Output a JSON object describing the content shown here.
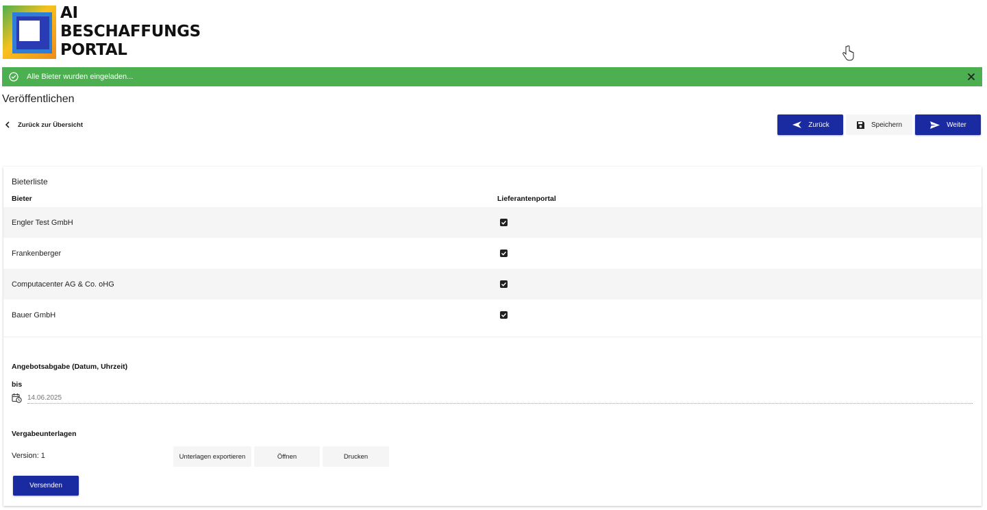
{
  "logo": {
    "line1": "AI",
    "line2": "BESCHAFFUNGS",
    "line3": "PORTAL"
  },
  "alert": {
    "message": "Alle Bieter wurden eingeladen...",
    "color": "#4caf50"
  },
  "page_title": "Veröffentlichen",
  "back_link": "Zurück zur Übersicht",
  "toolbar": {
    "back_label": "Zurück",
    "save_label": "Speichern",
    "next_label": "Weiter",
    "primary_color": "#1a2aa0"
  },
  "bidder_list": {
    "title": "Bieterliste",
    "columns": [
      "Bieter",
      "Lieferantenportal"
    ],
    "rows": [
      {
        "name": "Engler Test GmbH",
        "portal": true
      },
      {
        "name": "Frankenberger",
        "portal": true
      },
      {
        "name": "Computacenter AG & Co. oHG",
        "portal": true
      },
      {
        "name": "Bauer GmbH",
        "portal": true
      }
    ]
  },
  "offer": {
    "heading": "Angebotsabgabe (Datum, Uhrzeit)",
    "until_label": "bis",
    "date_placeholder": "14.06.2025"
  },
  "documents": {
    "heading": "Vergabeunterlagen",
    "version": "Version: 1",
    "export_label": "Unterlagen exportieren",
    "open_label": "Öffnen",
    "print_label": "Drucken"
  },
  "send_label": "Versenden"
}
